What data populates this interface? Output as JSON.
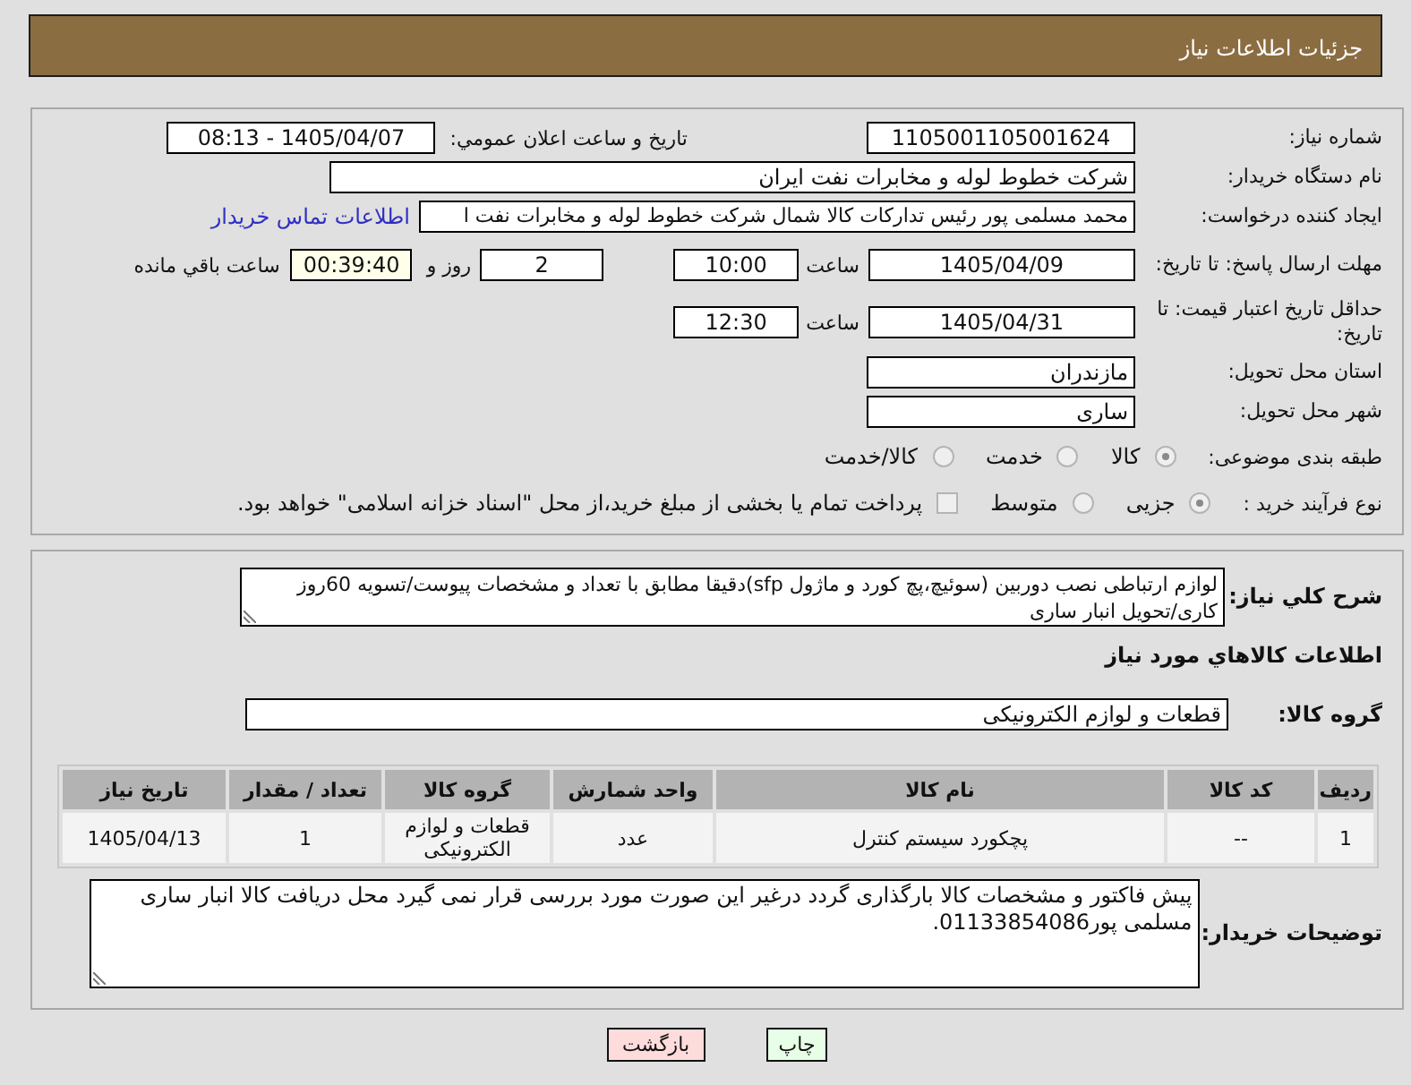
{
  "header": {
    "title": "جزئیات اطلاعات نیاز"
  },
  "details": {
    "need_number": {
      "label": "شماره نیاز:",
      "value": "1105001105001624"
    },
    "announcement": {
      "label": "تاریخ و ساعت اعلان عمومي:",
      "value": "1405/04/07 - 08:13"
    },
    "buyer_org": {
      "label": "نام دستگاه خریدار:",
      "value": "شرکت خطوط لوله و مخابرات نفت ایران"
    },
    "requester": {
      "label": "ایجاد کننده درخواست:",
      "value": "محمد مسلمی پور رئیس تدارکات کالا شمال شرکت خطوط لوله و مخابرات نفت ا",
      "contact_link": "اطلاعات تماس خریدار"
    },
    "reply_deadline": {
      "label": "مهلت ارسال پاسخ: تا تاریخ:",
      "date": "1405/04/09",
      "time_label": "ساعت",
      "time": "10:00",
      "days": "2",
      "days_label": "روز و",
      "remaining": "00:39:40",
      "remaining_label": "ساعت باقي مانده"
    },
    "price_validity": {
      "label": "حداقل تاریخ اعتبار قیمت: تا تاریخ:",
      "date": "1405/04/31",
      "time_label": "ساعت",
      "time": "12:30"
    },
    "province": {
      "label": "استان محل تحویل:",
      "value": "مازندران"
    },
    "city": {
      "label": "شهر محل تحویل:",
      "value": "ساری"
    },
    "category": {
      "label": "طبقه بندی موضوعی:",
      "options": [
        {
          "label": "کالا",
          "selected": true
        },
        {
          "label": "خدمت",
          "selected": false
        },
        {
          "label": "کالا/خدمت",
          "selected": false
        }
      ]
    },
    "purchase_type": {
      "label": "نوع فرآیند خرید :",
      "options": [
        {
          "label": "جزیی",
          "selected": true
        },
        {
          "label": "متوسط",
          "selected": false
        }
      ],
      "treasury": {
        "label": "پرداخت تمام یا بخشی از مبلغ خرید،از محل \"اسناد خزانه اسلامی\" خواهد بود.",
        "checked": false
      }
    }
  },
  "need": {
    "label": "شرح کلي نیاز:",
    "value": "لوازم ارتباطی نصب دوربین (سوئیچ،پچ کورد و ماژول sfp)دقیقا مطابق با تعداد و مشخصات پیوست/تسویه 60روز کاری/تحویل انبار ساری"
  },
  "goods": {
    "title": "اطلاعات کالاهاي مورد نیاز",
    "group": {
      "label": "گروه کالا:",
      "value": "قطعات و لوازم الکترونیکی"
    },
    "table": {
      "columns": [
        "ردیف",
        "کد کالا",
        "نام کالا",
        "واحد شمارش",
        "گروه کالا",
        "تعداد / مقدار",
        "تاریخ نیاز"
      ],
      "rows": [
        [
          "1",
          "--",
          "پچکورد سیستم کنترل",
          "عدد",
          "قطعات و لوازم الکترونیکی",
          "1",
          "1405/04/13"
        ]
      ]
    }
  },
  "buyer_notes": {
    "label": "توضیحات خریدار:",
    "value": "پیش فاکتور و مشخصات کالا بارگذاری گردد درغیر این صورت مورد بررسی قرار نمی گیرد محل دریافت کالا انبار ساری مسلمی پور01133854086."
  },
  "buttons": [
    {
      "label": "چاپ",
      "kind": "print"
    },
    {
      "label": "بازگشت",
      "kind": "back"
    }
  ]
}
